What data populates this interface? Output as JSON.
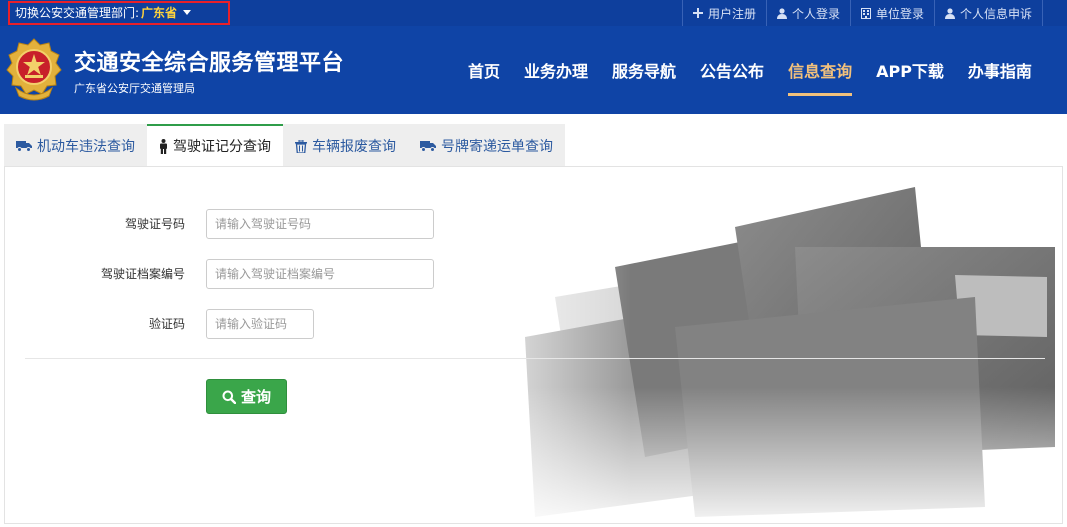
{
  "topbar": {
    "dept_label": "切换公安交通管理部门:",
    "dept_value": "广东省",
    "links": [
      {
        "icon": "plus-icon",
        "label": "用户注册"
      },
      {
        "icon": "user-icon",
        "label": "个人登录"
      },
      {
        "icon": "building-icon",
        "label": "单位登录"
      },
      {
        "icon": "user-icon",
        "label": "个人信息申诉"
      }
    ]
  },
  "header": {
    "title": "交通安全综合服务管理平台",
    "subtitle": "广东省公安厅交通管理局",
    "nav": [
      {
        "label": "首页",
        "active": false
      },
      {
        "label": "业务办理",
        "active": false
      },
      {
        "label": "服务导航",
        "active": false
      },
      {
        "label": "公告公布",
        "active": false
      },
      {
        "label": "信息查询",
        "active": true
      },
      {
        "label": "APP下载",
        "active": false
      },
      {
        "label": "办事指南",
        "active": false
      }
    ]
  },
  "tabs": [
    {
      "icon": "truck-icon",
      "label": "机动车违法查询",
      "active": false
    },
    {
      "icon": "person-icon",
      "label": "驾驶证记分查询",
      "active": true
    },
    {
      "icon": "trash-icon",
      "label": "车辆报废查询",
      "active": false
    },
    {
      "icon": "truck-icon",
      "label": "号牌寄递运单查询",
      "active": false
    }
  ],
  "form": {
    "license_no": {
      "label": "驾驶证号码",
      "placeholder": "请输入驾驶证号码",
      "value": ""
    },
    "file_no": {
      "label": "驾驶证档案编号",
      "placeholder": "请输入驾驶证档案编号",
      "value": ""
    },
    "captcha": {
      "label": "验证码",
      "placeholder": "请输入验证码",
      "value": ""
    },
    "submit_label": "查询"
  },
  "colors": {
    "header_bg": "#0f44a6",
    "accent_active": "#f2c17c",
    "button_green": "#3aa64a",
    "highlight_border": "#e8202a"
  }
}
